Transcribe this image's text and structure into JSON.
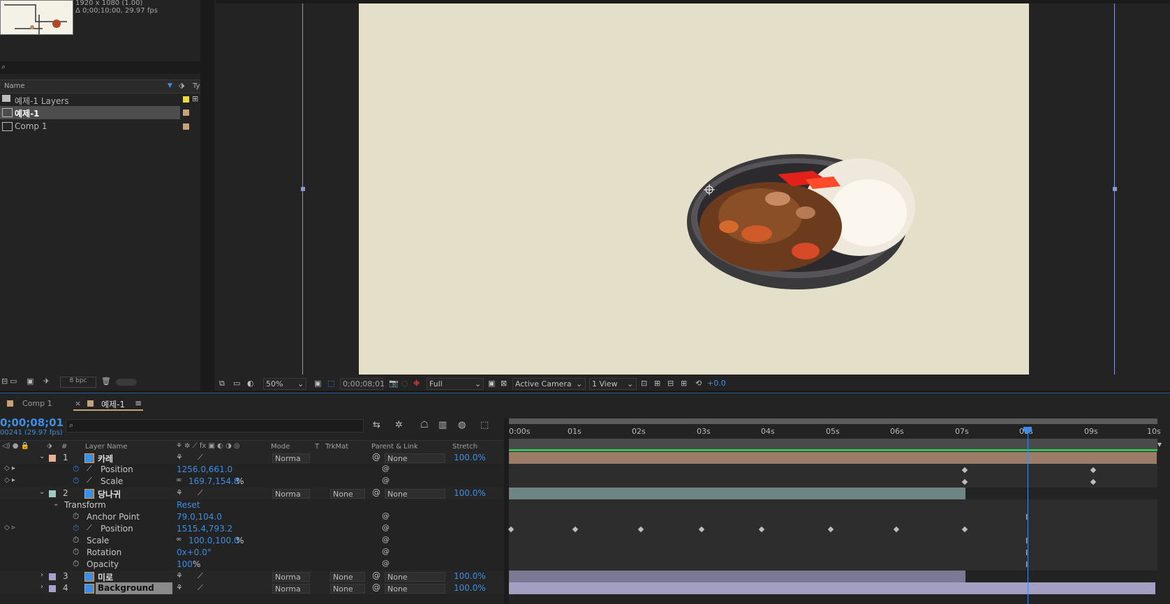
{
  "project": {
    "comp_info_1": "1920 x 1080 (1.00)",
    "comp_info_2": "Δ 0;00;10;00, 29.97 fps",
    "search_placeholder": "",
    "col_name": "Name",
    "col_type": "Ty",
    "items": [
      {
        "label": "예제-1 Layers",
        "color": "#e8d84a",
        "icon": "folder-icon"
      },
      {
        "label": "예제-1",
        "color": "#c4a27a",
        "icon": "composition-icon",
        "selected": true
      },
      {
        "label": "Comp 1",
        "color": "#c4a27a",
        "icon": "composition-icon"
      }
    ],
    "bpc": "8 bpc"
  },
  "viewer": {
    "zoom": "50%",
    "timecode": "0;00;08;01",
    "resolution": "Full",
    "camera": "Active Camera",
    "views": "1 View",
    "exposure": "+0.0"
  },
  "timeline": {
    "tabs": [
      {
        "label": "Comp 1"
      },
      {
        "label": "예제-1",
        "active": true
      }
    ],
    "current_time": "0;00;08;01",
    "frame_info": "00241 (29.97 fps)",
    "headers": {
      "num": "#",
      "layer_name": "Layer Name",
      "mode": "Mode",
      "t": "T",
      "trkmat": "TrkMat",
      "parent": "Parent & Link",
      "stretch": "Stretch"
    },
    "ruler": [
      "0:00s",
      "01s",
      "02s",
      "03s",
      "04s",
      "05s",
      "06s",
      "07s",
      "08s",
      "09s",
      "10s"
    ],
    "layers": [
      {
        "num": "1",
        "name": "카레",
        "color": "#e7b18f",
        "mode": "Norma",
        "trkmat": "",
        "parent": "None",
        "stretch": "100.0%"
      },
      {
        "num": "2",
        "name": "당나귀",
        "color": "#9ec8c4",
        "mode": "Norma",
        "trkmat": "None",
        "parent": "None",
        "stretch": "100.0%"
      },
      {
        "num": "3",
        "name": "미로",
        "color": "#a7a2cc",
        "mode": "Norma",
        "trkmat": "None",
        "parent": "None",
        "stretch": "100.0%"
      },
      {
        "num": "4",
        "name": "Background",
        "color": "#a7a2cc",
        "mode": "Norma",
        "trkmat": "None",
        "parent": "None",
        "stretch": "100.0%"
      }
    ],
    "props": {
      "l1_position": {
        "name": "Position",
        "value": "1256.0,661.0"
      },
      "l1_scale": {
        "name": "Scale",
        "value": "169.7,154.8",
        "unit": "%"
      },
      "transform": {
        "name": "Transform",
        "value": "Reset"
      },
      "anchor": {
        "name": "Anchor Point",
        "value": "79.0,104.0"
      },
      "l2_position": {
        "name": "Position",
        "value": "1515.4,793.2"
      },
      "l2_scale": {
        "name": "Scale",
        "value": "100.0,100.0",
        "unit": "%"
      },
      "rotation": {
        "name": "Rotation",
        "value": "0x+0.0°"
      },
      "opacity": {
        "name": "Opacity",
        "value": "100",
        "unit": "%"
      }
    }
  }
}
